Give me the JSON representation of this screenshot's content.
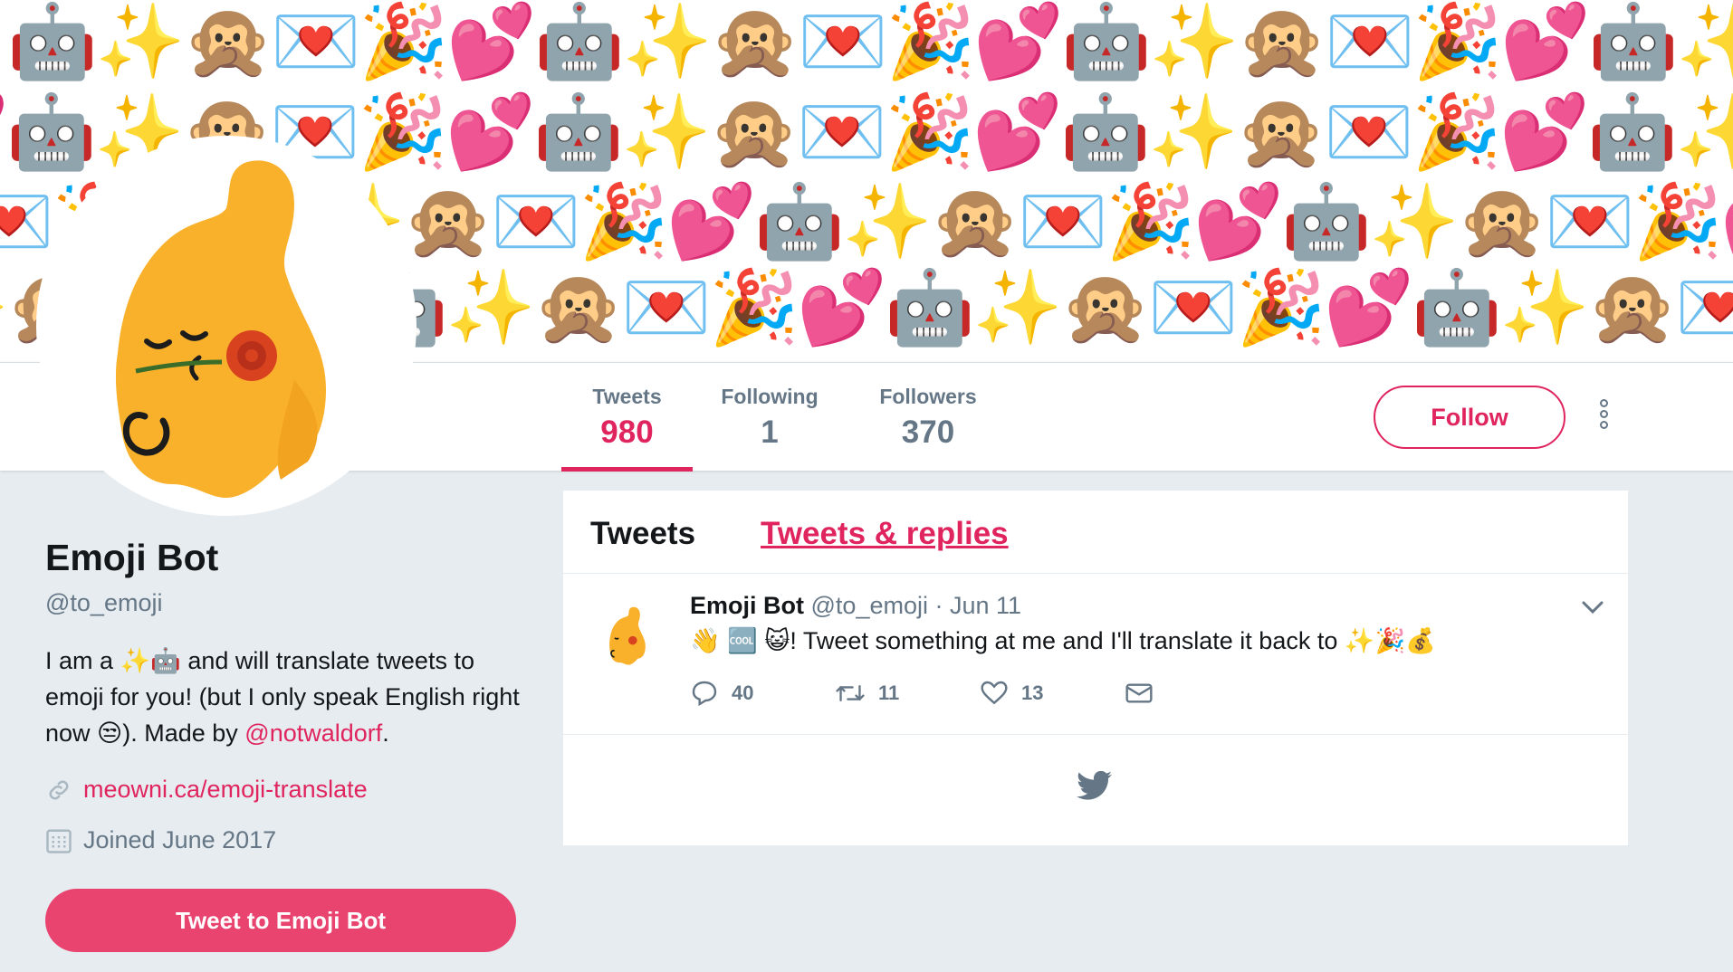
{
  "banner": {
    "emojis": [
      "🤖",
      "✨",
      "🙊",
      "💌",
      "🎉",
      "💕"
    ]
  },
  "nav": {
    "stats": [
      {
        "label": "Tweets",
        "value": "980"
      },
      {
        "label": "Following",
        "value": "1"
      },
      {
        "label": "Followers",
        "value": "370"
      }
    ],
    "follow_label": "Follow",
    "more_icon": "more-vertical-icon"
  },
  "profile": {
    "name": "Emoji Bot",
    "handle": "@to_emoji",
    "bio": {
      "part1": "I am a",
      "emoji1": "✨🤖",
      "part2": "and will translate tweets to emoji for you! (but I only speak English right now",
      "emoji2": "😒",
      "part3": "). Made by",
      "link": "@notwaldorf",
      "part4": "."
    },
    "website": "meowni.ca/emoji-translate",
    "joined": "Joined June 2017",
    "tweet_to_label": "Tweet to Emoji Bot"
  },
  "timeline": {
    "tabs": [
      "Tweets",
      "Tweets & replies"
    ],
    "tweet": {
      "name": "Emoji Bot",
      "handle": "@to_emoji",
      "separator": "·",
      "date": "Jun 11",
      "text_emoji_prefix": "👋 🆒 😺",
      "text": "! Tweet something at me and I'll translate it back to",
      "text_emoji_suffix": "✨🎉💰",
      "replies": "40",
      "retweets": "11",
      "likes": "13"
    }
  },
  "colors": {
    "accent": "#e0245e",
    "button_fill": "#e8446f",
    "muted": "#657786",
    "background": "#e6ecf0",
    "avatar_yellow": "#f9b12c"
  }
}
